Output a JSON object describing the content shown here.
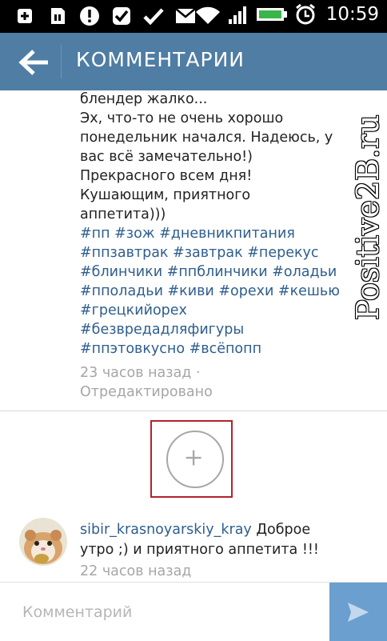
{
  "status_bar": {
    "time": "10:59",
    "icons_left": [
      "add-notification-icon",
      "sd-card-icon",
      "alert-icon",
      "check-box-icon",
      "check-icon",
      "gmail-icon"
    ],
    "icons_right": [
      "wifi-icon",
      "signal-icon",
      "battery-icon",
      "alarm-icon"
    ]
  },
  "app_bar": {
    "title": "КОММЕНТАРИИ",
    "color": "#4f7da3"
  },
  "post": {
    "lines": [
      {
        "text": "блендер жалко...",
        "type": "text"
      },
      {
        "text": "Эх, что-то не очень хорошо",
        "type": "text"
      },
      {
        "text": "понедельник начался. Надеюсь, у",
        "type": "text"
      },
      {
        "text": "вас всё замечательно!)",
        "type": "text"
      },
      {
        "text": "Прекрасного всем дня!",
        "type": "text"
      },
      {
        "text": "Кушающим, приятного",
        "type": "text"
      },
      {
        "text": "аппетита)))",
        "type": "text"
      },
      {
        "text": "#пп #зож #дневникпитания",
        "type": "tag"
      },
      {
        "text": "#ппзавтрак #завтрак #перекус",
        "type": "tag"
      },
      {
        "text": "#блинчики #ппблинчики #оладьи",
        "type": "tag"
      },
      {
        "text": "#пполадьи #киви #орехи #кешью",
        "type": "tag"
      },
      {
        "text": "#грецкийорех",
        "type": "tag"
      },
      {
        "text": "#безвредадляфигуры",
        "type": "tag"
      },
      {
        "text": "#ппэтовкусно #всёпопп",
        "type": "tag"
      }
    ],
    "meta_line1": "23 часов назад ·",
    "meta_line2": "Отредактировано"
  },
  "load_more": {
    "icon": "plus-icon",
    "highlight_color": "#b3222b"
  },
  "comment2": {
    "username": "sibir_krasnoyarskiy_kray",
    "text_part1": "Доброе",
    "text_part2": "утро ;) и приятного аппетита !!!",
    "time": "22 часов назад"
  },
  "input": {
    "placeholder": "Комментарий",
    "send_icon": "send-icon",
    "send_color": "#6a9fd0"
  },
  "watermark": "Positive2B.ru",
  "colors": {
    "link": "#2f5e8e",
    "meta": "#a6a6a6"
  }
}
